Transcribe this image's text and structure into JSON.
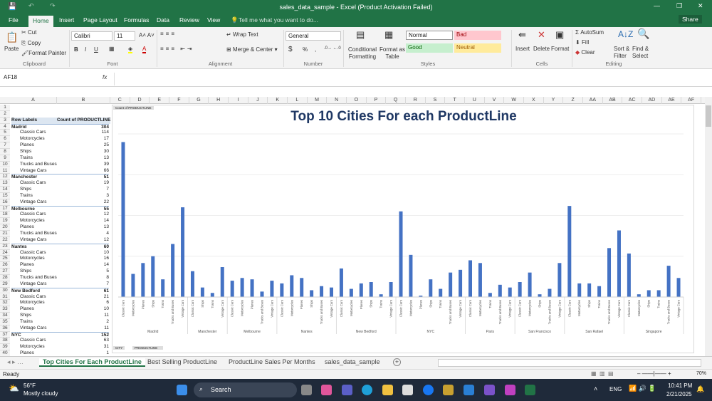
{
  "window": {
    "title": "sales_data_sample - Excel (Product Activation Failed)",
    "share": "Share"
  },
  "ribbon_tabs": [
    "File",
    "Home",
    "Insert",
    "Page Layout",
    "Formulas",
    "Data",
    "Review",
    "View"
  ],
  "tell_me": "Tell me what you want to do...",
  "clipboard": {
    "paste": "Paste",
    "cut": "Cut",
    "copy": "Copy",
    "format_painter": "Format Painter",
    "label": "Clipboard"
  },
  "font": {
    "name": "Calibri",
    "size": "11",
    "bold": "B",
    "italic": "I",
    "underline": "U",
    "label": "Font"
  },
  "alignment": {
    "wrap": "Wrap Text",
    "merge": "Merge & Center",
    "label": "Alignment"
  },
  "number": {
    "format": "General",
    "currency": "$",
    "percent": "%",
    "comma": ",",
    "label": "Number"
  },
  "styles": {
    "conditional": "Conditional Formatting",
    "format_table": "Format as Table",
    "normal": "Normal",
    "bad": "Bad",
    "good": "Good",
    "neutral": "Neutral",
    "label": "Styles"
  },
  "cells": {
    "insert": "Insert",
    "delete": "Delete",
    "format": "Format",
    "label": "Cells"
  },
  "editing": {
    "autosum": "AutoSum",
    "fill": "Fill",
    "clear": "Clear",
    "sort": "Sort & Filter",
    "find": "Find & Select",
    "label": "Editing"
  },
  "formula_bar": {
    "name_box": "AF18",
    "fx": "fx",
    "value": ""
  },
  "columns": [
    "A",
    "B",
    "C",
    "D",
    "E",
    "F",
    "G",
    "H",
    "I",
    "J",
    "K",
    "L",
    "M",
    "N",
    "O",
    "P",
    "Q",
    "R",
    "S",
    "T",
    "U",
    "V",
    "W",
    "X",
    "Y",
    "Z",
    "AA",
    "AB",
    "AC",
    "AD",
    "AE",
    "AF"
  ],
  "pivot": {
    "header_label": "Row Labels",
    "header_value": "Count of PRODUCTLINE",
    "rows": [
      {
        "r": "1",
        "l": "",
        "v": ""
      },
      {
        "r": "2",
        "l": "",
        "v": ""
      },
      {
        "r": "4",
        "l": "Madrid",
        "v": "304",
        "city": true
      },
      {
        "r": "5",
        "l": "Classic Cars",
        "v": "114"
      },
      {
        "r": "6",
        "l": "Motorcycles",
        "v": "17"
      },
      {
        "r": "7",
        "l": "Planes",
        "v": "25"
      },
      {
        "r": "8",
        "l": "Ships",
        "v": "30"
      },
      {
        "r": "9",
        "l": "Trains",
        "v": "13"
      },
      {
        "r": "10",
        "l": "Trucks and Buses",
        "v": "39"
      },
      {
        "r": "11",
        "l": "Vintage Cars",
        "v": "66"
      },
      {
        "r": "12",
        "l": "Manchester",
        "v": "51",
        "city": true
      },
      {
        "r": "13",
        "l": "Classic Cars",
        "v": "19"
      },
      {
        "r": "14",
        "l": "Ships",
        "v": "7"
      },
      {
        "r": "15",
        "l": "Trains",
        "v": "3"
      },
      {
        "r": "16",
        "l": "Vintage Cars",
        "v": "22"
      },
      {
        "r": "17",
        "l": "Melbourne",
        "v": "55",
        "city": true
      },
      {
        "r": "18",
        "l": "Classic Cars",
        "v": "12"
      },
      {
        "r": "19",
        "l": "Motorcycles",
        "v": "14"
      },
      {
        "r": "20",
        "l": "Planes",
        "v": "13"
      },
      {
        "r": "21",
        "l": "Trucks and Buses",
        "v": "4"
      },
      {
        "r": "22",
        "l": "Vintage Cars",
        "v": "12"
      },
      {
        "r": "23",
        "l": "Nantes",
        "v": "60",
        "city": true
      },
      {
        "r": "24",
        "l": "Classic Cars",
        "v": "10"
      },
      {
        "r": "25",
        "l": "Motorcycles",
        "v": "16"
      },
      {
        "r": "26",
        "l": "Planes",
        "v": "14"
      },
      {
        "r": "27",
        "l": "Ships",
        "v": "5"
      },
      {
        "r": "28",
        "l": "Trucks and Buses",
        "v": "8"
      },
      {
        "r": "29",
        "l": "Vintage Cars",
        "v": "7"
      },
      {
        "r": "30",
        "l": "New Bedford",
        "v": "61",
        "city": true
      },
      {
        "r": "31",
        "l": "Classic Cars",
        "v": "21"
      },
      {
        "r": "32",
        "l": "Motorcycles",
        "v": "6"
      },
      {
        "r": "33",
        "l": "Planes",
        "v": "10"
      },
      {
        "r": "34",
        "l": "Ships",
        "v": "11"
      },
      {
        "r": "35",
        "l": "Trains",
        "v": "2"
      },
      {
        "r": "36",
        "l": "Vintage Cars",
        "v": "11"
      },
      {
        "r": "37",
        "l": "NYC",
        "v": "152",
        "city": true
      },
      {
        "r": "38",
        "l": "Classic Cars",
        "v": "63"
      },
      {
        "r": "39",
        "l": "Motorcycles",
        "v": "31"
      },
      {
        "r": "40",
        "l": "Planes",
        "v": "1"
      }
    ]
  },
  "chart_data": {
    "type": "bar",
    "title": "Top 10 Cities For each ProductLine",
    "field_button": "Count of PRODUCTLINE",
    "axis_buttons": [
      "CITY",
      "PRODUCTLINE"
    ],
    "ylim": [
      0,
      120
    ],
    "color": "#4472c4",
    "groups": [
      {
        "city": "Madrid",
        "items": [
          [
            "Classic Cars",
            114
          ],
          [
            "Motorcycles",
            17
          ],
          [
            "Planes",
            25
          ],
          [
            "Ships",
            30
          ],
          [
            "Trains",
            13
          ],
          [
            "Trucks and Buses",
            39
          ],
          [
            "Vintage Cars",
            66
          ]
        ]
      },
      {
        "city": "Manchester",
        "items": [
          [
            "Classic Cars",
            19
          ],
          [
            "Ships",
            7
          ],
          [
            "Trains",
            3
          ],
          [
            "Vintage Cars",
            22
          ]
        ]
      },
      {
        "city": "Melbourne",
        "items": [
          [
            "Classic Cars",
            12
          ],
          [
            "Motorcycles",
            14
          ],
          [
            "Planes",
            13
          ],
          [
            "Trucks and Buses",
            4
          ],
          [
            "Vintage Cars",
            12
          ]
        ]
      },
      {
        "city": "Nantes",
        "items": [
          [
            "Classic Cars",
            10
          ],
          [
            "Motorcycles",
            16
          ],
          [
            "Planes",
            14
          ],
          [
            "Ships",
            5
          ],
          [
            "Trucks and Buses",
            8
          ],
          [
            "Vintage Cars",
            7
          ]
        ]
      },
      {
        "city": "New Bedford",
        "items": [
          [
            "Classic Cars",
            21
          ],
          [
            "Motorcycles",
            6
          ],
          [
            "Planes",
            10
          ],
          [
            "Ships",
            11
          ],
          [
            "Trains",
            2
          ],
          [
            "Vintage Cars",
            11
          ]
        ]
      },
      {
        "city": "NYC",
        "items": [
          [
            "Classic Cars",
            63
          ],
          [
            "Motorcycles",
            31
          ],
          [
            "Planes",
            1
          ],
          [
            "Ships",
            13
          ],
          [
            "Trains",
            6
          ],
          [
            "Trucks and Buses",
            18
          ],
          [
            "Vintage Cars",
            20
          ]
        ]
      },
      {
        "city": "Paris",
        "items": [
          [
            "Classic Cars",
            27
          ],
          [
            "Motorcycles",
            25
          ],
          [
            "Trains",
            3
          ],
          [
            "Trucks and Buses",
            9
          ],
          [
            "Vintage Cars",
            7
          ]
        ]
      },
      {
        "city": "San Francisco",
        "items": [
          [
            "Classic Cars",
            11
          ],
          [
            "Motorcycles",
            18
          ],
          [
            "Ships",
            2
          ],
          [
            "Trucks and Buses",
            6
          ],
          [
            "Vintage Cars",
            25
          ]
        ]
      },
      {
        "city": "San Rafael",
        "items": [
          [
            "Classic Cars",
            67
          ],
          [
            "Motorcycles",
            10
          ],
          [
            "Ships",
            10
          ],
          [
            "Trains",
            8
          ],
          [
            "Trucks and Buses",
            36
          ],
          [
            "Vintage Cars",
            49
          ]
        ]
      },
      {
        "city": "Singapore",
        "items": [
          [
            "Classic Cars",
            32
          ],
          [
            "Motorcycles",
            2
          ],
          [
            "Ships",
            5
          ],
          [
            "Trains",
            5
          ],
          [
            "Trucks and Buses",
            23
          ],
          [
            "Vintage Cars",
            14
          ]
        ]
      }
    ]
  },
  "sheet_tabs": [
    "Top Cities For Each ProductLine",
    "Best Selling ProductLine",
    "ProductLine Sales Per Months",
    "sales_data_sample"
  ],
  "status": {
    "ready": "Ready",
    "zoom": "70%"
  },
  "taskbar": {
    "temp": "56°F",
    "weather": "Mostly cloudy",
    "search": "Search",
    "lang": "ENG",
    "time": "10:41 PM",
    "date": "2/21/2025"
  }
}
